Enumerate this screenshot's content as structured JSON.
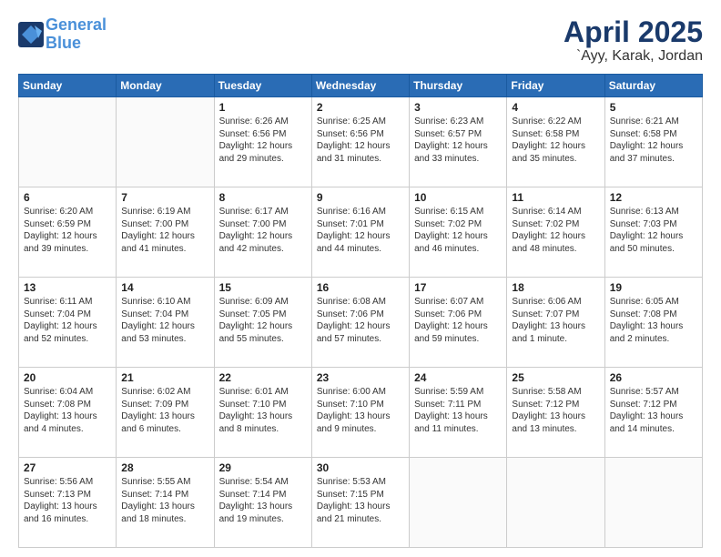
{
  "header": {
    "logo_line1": "General",
    "logo_line2": "Blue",
    "month": "April 2025",
    "location": "`Ayy, Karak, Jordan"
  },
  "weekdays": [
    "Sunday",
    "Monday",
    "Tuesday",
    "Wednesday",
    "Thursday",
    "Friday",
    "Saturday"
  ],
  "weeks": [
    [
      {
        "day": "",
        "text": ""
      },
      {
        "day": "",
        "text": ""
      },
      {
        "day": "1",
        "text": "Sunrise: 6:26 AM\nSunset: 6:56 PM\nDaylight: 12 hours\nand 29 minutes."
      },
      {
        "day": "2",
        "text": "Sunrise: 6:25 AM\nSunset: 6:56 PM\nDaylight: 12 hours\nand 31 minutes."
      },
      {
        "day": "3",
        "text": "Sunrise: 6:23 AM\nSunset: 6:57 PM\nDaylight: 12 hours\nand 33 minutes."
      },
      {
        "day": "4",
        "text": "Sunrise: 6:22 AM\nSunset: 6:58 PM\nDaylight: 12 hours\nand 35 minutes."
      },
      {
        "day": "5",
        "text": "Sunrise: 6:21 AM\nSunset: 6:58 PM\nDaylight: 12 hours\nand 37 minutes."
      }
    ],
    [
      {
        "day": "6",
        "text": "Sunrise: 6:20 AM\nSunset: 6:59 PM\nDaylight: 12 hours\nand 39 minutes."
      },
      {
        "day": "7",
        "text": "Sunrise: 6:19 AM\nSunset: 7:00 PM\nDaylight: 12 hours\nand 41 minutes."
      },
      {
        "day": "8",
        "text": "Sunrise: 6:17 AM\nSunset: 7:00 PM\nDaylight: 12 hours\nand 42 minutes."
      },
      {
        "day": "9",
        "text": "Sunrise: 6:16 AM\nSunset: 7:01 PM\nDaylight: 12 hours\nand 44 minutes."
      },
      {
        "day": "10",
        "text": "Sunrise: 6:15 AM\nSunset: 7:02 PM\nDaylight: 12 hours\nand 46 minutes."
      },
      {
        "day": "11",
        "text": "Sunrise: 6:14 AM\nSunset: 7:02 PM\nDaylight: 12 hours\nand 48 minutes."
      },
      {
        "day": "12",
        "text": "Sunrise: 6:13 AM\nSunset: 7:03 PM\nDaylight: 12 hours\nand 50 minutes."
      }
    ],
    [
      {
        "day": "13",
        "text": "Sunrise: 6:11 AM\nSunset: 7:04 PM\nDaylight: 12 hours\nand 52 minutes."
      },
      {
        "day": "14",
        "text": "Sunrise: 6:10 AM\nSunset: 7:04 PM\nDaylight: 12 hours\nand 53 minutes."
      },
      {
        "day": "15",
        "text": "Sunrise: 6:09 AM\nSunset: 7:05 PM\nDaylight: 12 hours\nand 55 minutes."
      },
      {
        "day": "16",
        "text": "Sunrise: 6:08 AM\nSunset: 7:06 PM\nDaylight: 12 hours\nand 57 minutes."
      },
      {
        "day": "17",
        "text": "Sunrise: 6:07 AM\nSunset: 7:06 PM\nDaylight: 12 hours\nand 59 minutes."
      },
      {
        "day": "18",
        "text": "Sunrise: 6:06 AM\nSunset: 7:07 PM\nDaylight: 13 hours\nand 1 minute."
      },
      {
        "day": "19",
        "text": "Sunrise: 6:05 AM\nSunset: 7:08 PM\nDaylight: 13 hours\nand 2 minutes."
      }
    ],
    [
      {
        "day": "20",
        "text": "Sunrise: 6:04 AM\nSunset: 7:08 PM\nDaylight: 13 hours\nand 4 minutes."
      },
      {
        "day": "21",
        "text": "Sunrise: 6:02 AM\nSunset: 7:09 PM\nDaylight: 13 hours\nand 6 minutes."
      },
      {
        "day": "22",
        "text": "Sunrise: 6:01 AM\nSunset: 7:10 PM\nDaylight: 13 hours\nand 8 minutes."
      },
      {
        "day": "23",
        "text": "Sunrise: 6:00 AM\nSunset: 7:10 PM\nDaylight: 13 hours\nand 9 minutes."
      },
      {
        "day": "24",
        "text": "Sunrise: 5:59 AM\nSunset: 7:11 PM\nDaylight: 13 hours\nand 11 minutes."
      },
      {
        "day": "25",
        "text": "Sunrise: 5:58 AM\nSunset: 7:12 PM\nDaylight: 13 hours\nand 13 minutes."
      },
      {
        "day": "26",
        "text": "Sunrise: 5:57 AM\nSunset: 7:12 PM\nDaylight: 13 hours\nand 14 minutes."
      }
    ],
    [
      {
        "day": "27",
        "text": "Sunrise: 5:56 AM\nSunset: 7:13 PM\nDaylight: 13 hours\nand 16 minutes."
      },
      {
        "day": "28",
        "text": "Sunrise: 5:55 AM\nSunset: 7:14 PM\nDaylight: 13 hours\nand 18 minutes."
      },
      {
        "day": "29",
        "text": "Sunrise: 5:54 AM\nSunset: 7:14 PM\nDaylight: 13 hours\nand 19 minutes."
      },
      {
        "day": "30",
        "text": "Sunrise: 5:53 AM\nSunset: 7:15 PM\nDaylight: 13 hours\nand 21 minutes."
      },
      {
        "day": "",
        "text": ""
      },
      {
        "day": "",
        "text": ""
      },
      {
        "day": "",
        "text": ""
      }
    ]
  ]
}
